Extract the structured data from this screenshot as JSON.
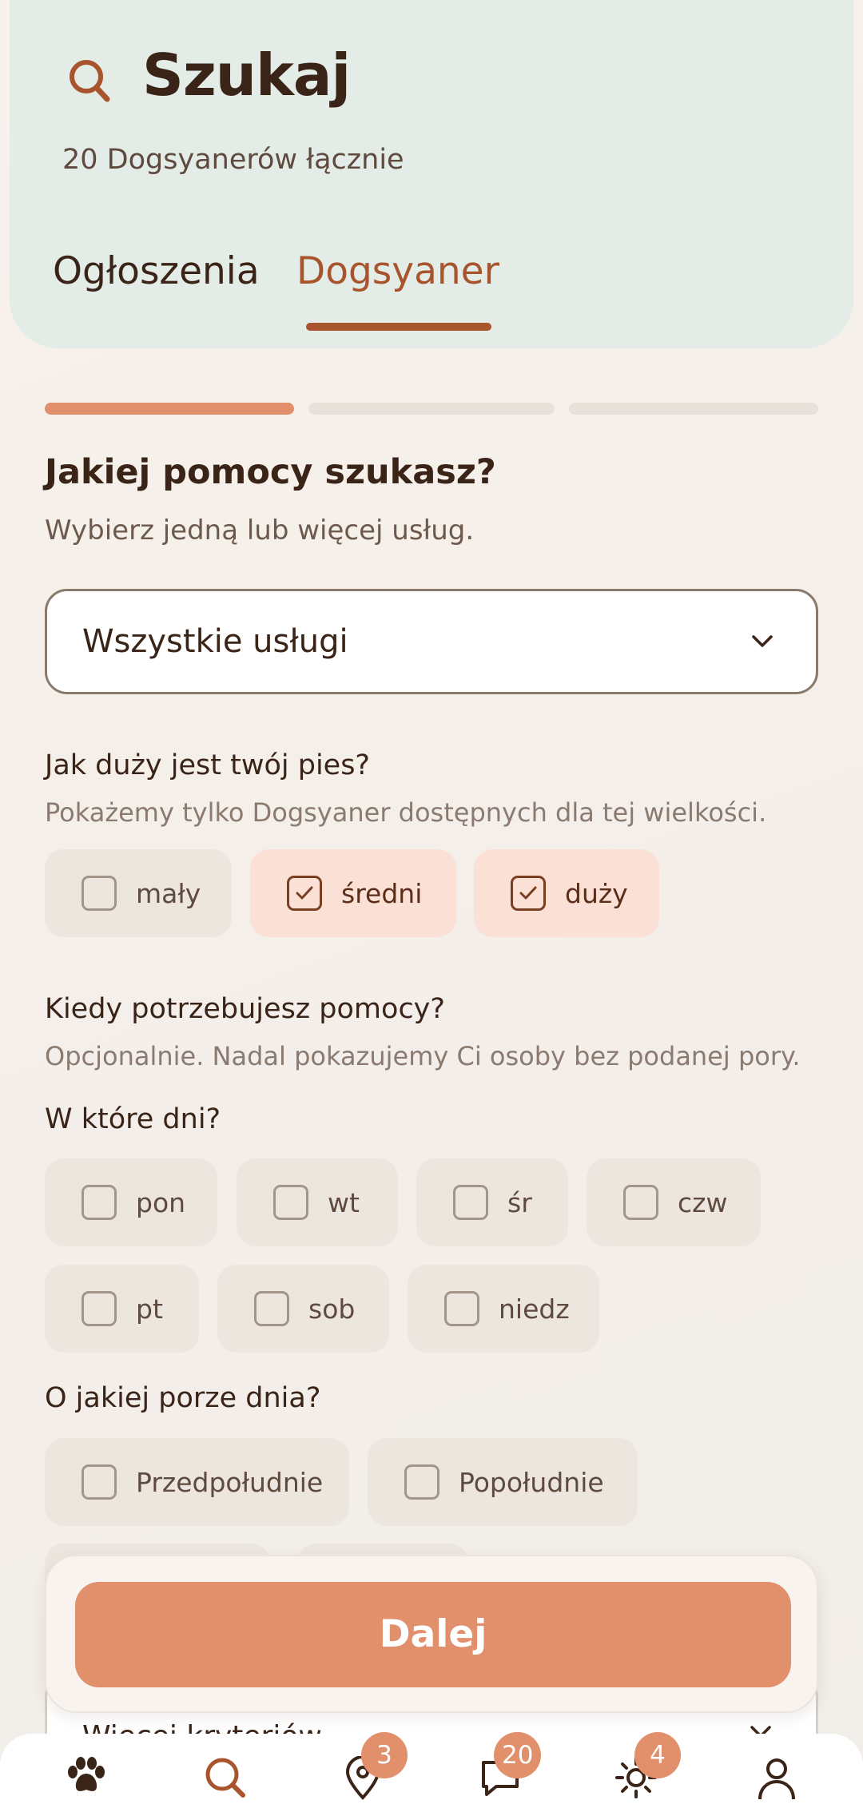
{
  "header": {
    "title": "Szukaj",
    "subtitle": "20 Dogsyanerów łącznie",
    "tabs": [
      {
        "label": "Ogłoszenia",
        "active": false
      },
      {
        "label": "Dogsyaner",
        "active": true
      }
    ]
  },
  "progress": {
    "current_step": 1,
    "total_steps": 3
  },
  "services": {
    "heading": "Jakiej pomocy szukasz?",
    "description": "Wybierz jedną lub więcej usług.",
    "select_value": "Wszystkie usługi"
  },
  "size": {
    "question": "Jak duży jest twój pies?",
    "hint": "Pokażemy tylko Dogsyaner dostępnych dla tej wielkości.",
    "options": [
      {
        "label": "mały",
        "checked": false
      },
      {
        "label": "średni",
        "checked": true
      },
      {
        "label": "duży",
        "checked": true
      }
    ]
  },
  "when": {
    "question": "Kiedy potrzebujesz pomocy?",
    "hint": "Opcjonalnie. Nadal pokazujemy Ci osoby bez podanej pory.",
    "days_label": "W które dni?",
    "days": [
      {
        "label": "pon",
        "checked": false
      },
      {
        "label": "wt",
        "checked": false
      },
      {
        "label": "śr",
        "checked": false
      },
      {
        "label": "czw",
        "checked": false
      },
      {
        "label": "pt",
        "checked": false
      },
      {
        "label": "sob",
        "checked": false
      },
      {
        "label": "niedz",
        "checked": false
      }
    ],
    "time_label": "O jakiej porze dnia?",
    "times": [
      {
        "label": "Przedpołudnie",
        "checked": false
      },
      {
        "label": "Popołudnie",
        "checked": false
      }
    ]
  },
  "more_criteria": "Więcej kryteriów",
  "cta": {
    "label": "Dalej"
  },
  "nav": {
    "items": [
      {
        "icon": "paw-icon",
        "active": false,
        "badge": ""
      },
      {
        "icon": "search-icon",
        "active": true,
        "badge": ""
      },
      {
        "icon": "location-pin-icon",
        "active": false,
        "badge": "3"
      },
      {
        "icon": "chat-icon",
        "active": false,
        "badge": "20"
      },
      {
        "icon": "sun-icon",
        "active": false,
        "badge": "4"
      },
      {
        "icon": "profile-icon",
        "active": false,
        "badge": ""
      }
    ]
  },
  "colors": {
    "accent": "#e28f6c",
    "accent_dark": "#a8552e",
    "header_bg": "#e3ece7",
    "checked_chip_bg": "#fbe0d5",
    "chip_bg": "#ede6df"
  }
}
